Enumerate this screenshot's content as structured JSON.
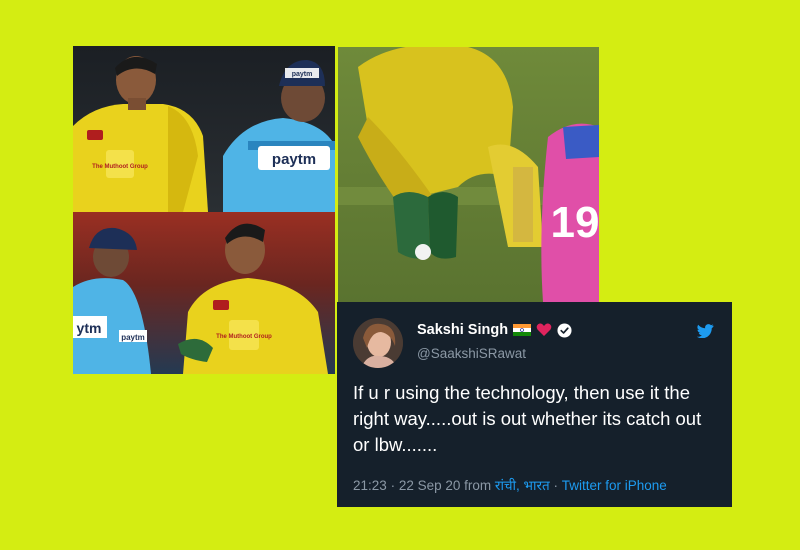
{
  "photos": {
    "top_left": {
      "sponsor_text": "paytm",
      "cap_text": "paytm",
      "shirt_brand": "The Muthoot Group"
    },
    "bottom_left": {
      "sponsor_text": "ytm",
      "sleeve_text": "paytm",
      "shirt_brand": "The Muthoot Group"
    },
    "right": {
      "jersey_number": "19"
    }
  },
  "tweet": {
    "display_name": "Sakshi Singh",
    "handle": "@SaakshiSRawat",
    "text": "If u r using the technology, then use it the right way.....out is out whether its catch out or lbw.......",
    "time": "21:23",
    "date": "22 Sep 20",
    "from_label": "from",
    "location": "रांची, भारत",
    "client": "Twitter for iPhone",
    "separator": "·",
    "icons": [
      "india-flag-icon",
      "red-heart-icon",
      "verified-badge-icon",
      "twitter-bird-icon"
    ],
    "colors": {
      "background": "#15202b",
      "link": "#1d9bf0",
      "muted": "#8b98a5"
    }
  },
  "page": {
    "background": "#d4ed12"
  }
}
